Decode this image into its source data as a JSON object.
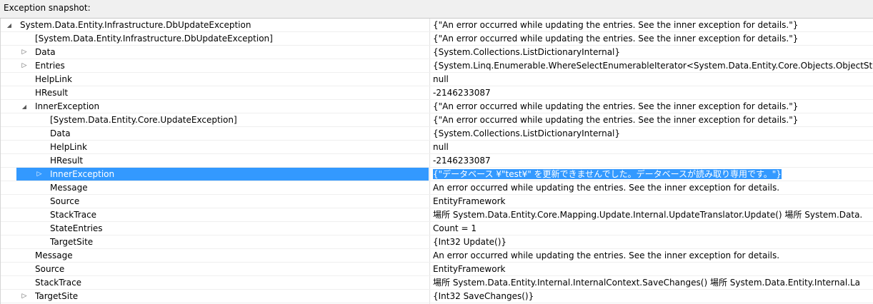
{
  "header": {
    "title": "Exception snapshot:"
  },
  "rows": [
    {
      "level": 0,
      "expander": "expanded",
      "name": "System.Data.Entity.Infrastructure.DbUpdateException",
      "value": "{\"An error occurred while updating the entries. See the inner exception for details.\"}"
    },
    {
      "level": 1,
      "expander": "none",
      "name": "[System.Data.Entity.Infrastructure.DbUpdateException]",
      "value": "{\"An error occurred while updating the entries. See the inner exception for details.\"}"
    },
    {
      "level": 1,
      "expander": "collapsed",
      "name": "Data",
      "value": "{System.Collections.ListDictionaryInternal}"
    },
    {
      "level": 1,
      "expander": "collapsed",
      "name": "Entries",
      "value": "{System.Linq.Enumerable.WhereSelectEnumerableIterator<System.Data.Entity.Core.Objects.ObjectStat"
    },
    {
      "level": 1,
      "expander": "none",
      "name": "HelpLink",
      "value": "null"
    },
    {
      "level": 1,
      "expander": "none",
      "name": "HResult",
      "value": "-2146233087"
    },
    {
      "level": 1,
      "expander": "expanded",
      "name": "InnerException",
      "value": "{\"An error occurred while updating the entries. See the inner exception for details.\"}"
    },
    {
      "level": 2,
      "expander": "none",
      "name": "[System.Data.Entity.Core.UpdateException]",
      "value": "{\"An error occurred while updating the entries. See the inner exception for details.\"}"
    },
    {
      "level": 2,
      "expander": "none",
      "name": "Data",
      "value": "{System.Collections.ListDictionaryInternal}"
    },
    {
      "level": 2,
      "expander": "none",
      "name": "HelpLink",
      "value": "null"
    },
    {
      "level": 2,
      "expander": "none",
      "name": "HResult",
      "value": "-2146233087"
    },
    {
      "level": 2,
      "expander": "collapsed",
      "name": "InnerException",
      "value": "{\"データベース ¥\"test¥\" を更新できませんでした。データベースが読み取り専用です。\"}",
      "selected": true
    },
    {
      "level": 2,
      "expander": "none",
      "name": "Message",
      "value": "An error occurred while updating the entries. See the inner exception for details."
    },
    {
      "level": 2,
      "expander": "none",
      "name": "Source",
      "value": "EntityFramework"
    },
    {
      "level": 2,
      "expander": "none",
      "name": "StackTrace",
      "value": "   場所 System.Data.Entity.Core.Mapping.Update.Internal.UpdateTranslator.Update()   場所 System.Data."
    },
    {
      "level": 2,
      "expander": "none",
      "name": "StateEntries",
      "value": "Count = 1"
    },
    {
      "level": 2,
      "expander": "none",
      "name": "TargetSite",
      "value": "{Int32 Update()}"
    },
    {
      "level": 1,
      "expander": "none",
      "name": "Message",
      "value": "An error occurred while updating the entries. See the inner exception for details."
    },
    {
      "level": 1,
      "expander": "none",
      "name": "Source",
      "value": "EntityFramework"
    },
    {
      "level": 1,
      "expander": "none",
      "name": "StackTrace",
      "value": "   場所 System.Data.Entity.Internal.InternalContext.SaveChanges()   場所 System.Data.Entity.Internal.La"
    },
    {
      "level": 1,
      "expander": "collapsed",
      "name": "TargetSite",
      "value": "{Int32 SaveChanges()}"
    }
  ],
  "colors": {
    "selection": "#3399ff",
    "header_bg": "#f0f0f0"
  }
}
